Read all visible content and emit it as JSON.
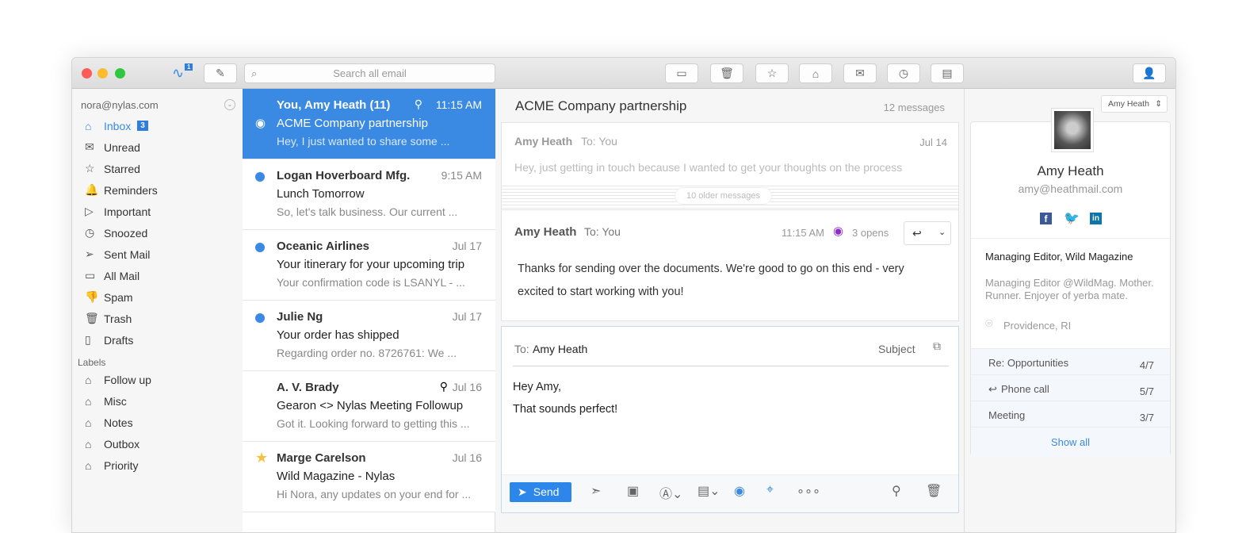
{
  "toolbar": {
    "activity_badge": "1",
    "search_placeholder": "Search all email",
    "icons": [
      "archive-icon",
      "trash-icon",
      "star-icon",
      "tag-icon",
      "mail-settings-icon",
      "clock-icon",
      "move-folder-icon"
    ]
  },
  "sidebar": {
    "account": "nora@nylas.com",
    "items": [
      {
        "label": "Inbox",
        "icon": "inbox-icon",
        "badge": "3"
      },
      {
        "label": "Unread",
        "icon": "unread-icon"
      },
      {
        "label": "Starred",
        "icon": "star-icon"
      },
      {
        "label": "Reminders",
        "icon": "bell-icon"
      },
      {
        "label": "Important",
        "icon": "label-icon"
      },
      {
        "label": "Snoozed",
        "icon": "clock-icon"
      },
      {
        "label": "Sent Mail",
        "icon": "send-icon"
      },
      {
        "label": "All Mail",
        "icon": "folder-icon"
      },
      {
        "label": "Spam",
        "icon": "thumbs-down-icon"
      },
      {
        "label": "Trash",
        "icon": "trash-icon"
      },
      {
        "label": "Drafts",
        "icon": "draft-icon"
      }
    ],
    "labels_heading": "Labels",
    "labels": [
      "Follow up",
      "Misc",
      "Notes",
      "Outbox",
      "Priority"
    ]
  },
  "list": [
    {
      "from": "You, Amy Heath (11)",
      "time": "11:15 AM",
      "subject": "ACME Company partnership",
      "snippet": "Hey, I just wanted to share some ...",
      "selected": true,
      "lead": "eye",
      "attach": true
    },
    {
      "from": "Logan Hoverboard Mfg.",
      "time": "9:15 AM",
      "subject": "Lunch Tomorrow",
      "snippet": "So, let's talk business. Our current ...",
      "lead": "unread"
    },
    {
      "from": "Oceanic Airlines",
      "time": "Jul 17",
      "subject": "Your itinerary for your upcoming trip",
      "snippet": "Your confirmation code is LSANYL - ...",
      "lead": "unread"
    },
    {
      "from": "Julie Ng",
      "time": "Jul 17",
      "subject": "Your order has shipped",
      "snippet": "Regarding order no. 8726761: We ...",
      "lead": "unread"
    },
    {
      "from": "A. V. Brady",
      "time": "Jul 16",
      "subject": "Gearon <> Nylas Meeting Followup",
      "snippet": "Got it. Looking forward to getting this ...",
      "attach": true
    },
    {
      "from": "Marge Carelson",
      "time": "Jul 16",
      "subject": "Wild Magazine - Nylas",
      "snippet": "Hi Nora, any updates on your end for ...",
      "lead": "star"
    }
  ],
  "thread": {
    "title": "ACME Company partnership",
    "count": "12 messages",
    "old": {
      "from": "Amy Heath",
      "to": "To: You",
      "date": "Jul 14",
      "snippet": "Hey, just getting in touch because I wanted to get your thoughts on the process"
    },
    "older": "10 older messages",
    "msg": {
      "from": "Amy Heath",
      "to": "To: You",
      "time": "11:15 AM",
      "opens": "3 opens",
      "body": "Thanks for sending over the documents. We're good to go on this end - very excited to start working with you!"
    },
    "compose": {
      "to_label": "To:",
      "to": "Amy Heath",
      "subject": "Subject",
      "line1": "Hey Amy,",
      "line2": "That sounds perfect!",
      "send": "Send"
    }
  },
  "contact": {
    "selector": "Amy Heath",
    "name": "Amy Heath",
    "email": "amy@heathmail.com",
    "title": "Managing Editor, Wild Magazine",
    "bio": "Managing Editor @WildMag. Mother. Runner. Enjoyer of yerba mate.",
    "location": "Providence, RI",
    "threads": [
      {
        "label": "Re: Opportunities",
        "count": "4/7"
      },
      {
        "label": "Phone call",
        "count": "5/7"
      },
      {
        "label": "Meeting",
        "count": "3/7"
      }
    ],
    "show_all": "Show all"
  },
  "colors": {
    "accent": "#3a8ae4",
    "opens": "#8e2bd1"
  }
}
